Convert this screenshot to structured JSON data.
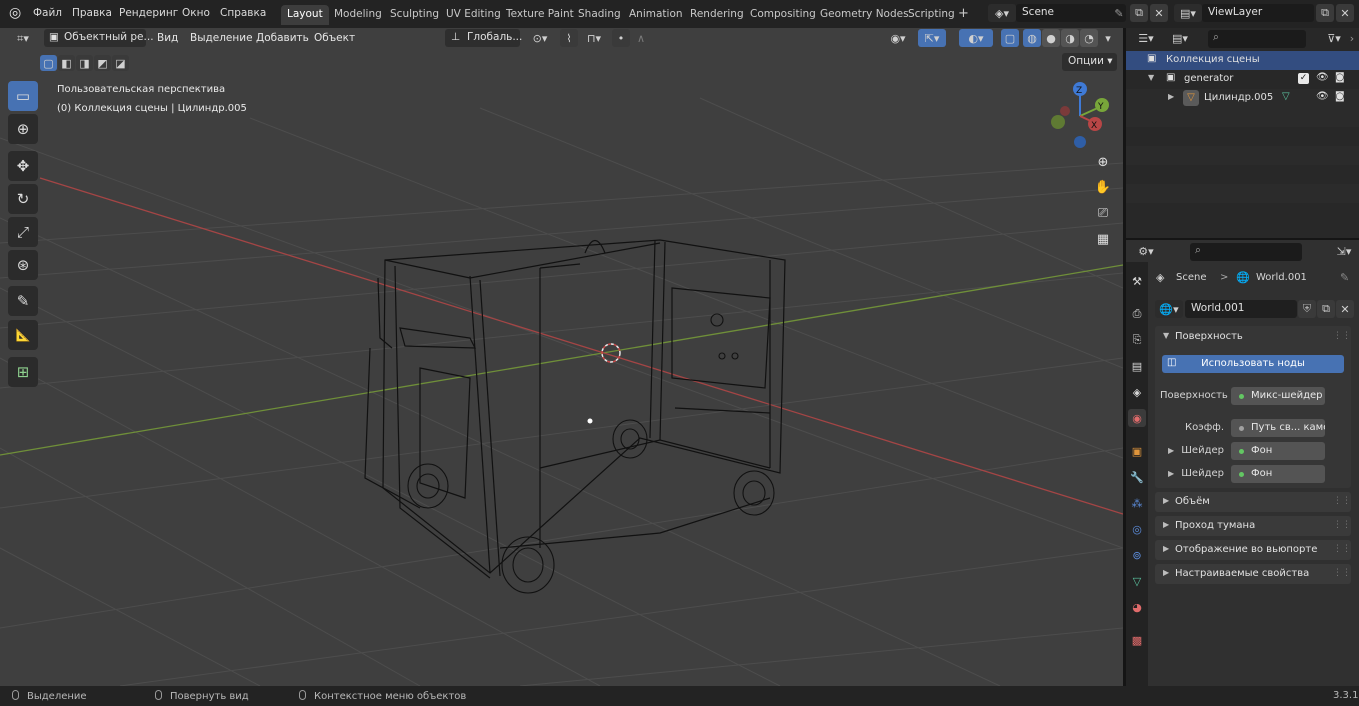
{
  "menu": [
    "Файл",
    "Правка",
    "Рендеринг",
    "Окно",
    "Справка"
  ],
  "workspaces": [
    "Layout",
    "Modeling",
    "Sculpting",
    "UV Editing",
    "Texture Paint",
    "Shading",
    "Animation",
    "Rendering",
    "Compositing",
    "Geometry Nodes",
    "Scripting"
  ],
  "active_workspace": "Layout",
  "add_workspace": "+",
  "scene_name": "Scene",
  "view_layer": "ViewLayer",
  "viewport_header": {
    "mode": "Объектный ре...",
    "menus": [
      "Вид",
      "Выделение",
      "Добавить",
      "Объект"
    ],
    "transform_orientation": "Глобаль...",
    "options": "Опции"
  },
  "viewport_overlay": {
    "view_name": "Пользовательская перспектива",
    "collection_info": "(0) Коллекция сцены | Цилиндр.005"
  },
  "gizmo_axes": {
    "x": "X",
    "y": "Y",
    "z": "Z"
  },
  "tools": [
    {
      "name": "select-box-tool",
      "icon": "▭"
    },
    {
      "name": "cursor-tool",
      "icon": "⊕"
    },
    {
      "name": "move-tool",
      "icon": "✥"
    },
    {
      "name": "rotate-tool",
      "icon": "↻"
    },
    {
      "name": "scale-tool",
      "icon": "⤢"
    },
    {
      "name": "transform-tool",
      "icon": "⊛"
    },
    {
      "name": "annotate-tool",
      "icon": "✎"
    },
    {
      "name": "measure-tool",
      "icon": "📐"
    },
    {
      "name": "add-cube-tool",
      "icon": "⊞"
    }
  ],
  "outliner": {
    "search_placeholder": "",
    "rows": [
      {
        "label": "Коллекция сцены",
        "level": 0
      },
      {
        "label": "generator",
        "level": 1
      },
      {
        "label": "Цилиндр.005",
        "level": 2
      }
    ]
  },
  "properties": {
    "breadcrumb_scene": "Scene",
    "breadcrumb_sep": ">",
    "breadcrumb_world": "World.001",
    "world_name": "World.001",
    "surface_panel": "Поверхность",
    "use_nodes_button": "Использовать ноды",
    "fields": [
      {
        "label": "Поверхность",
        "value": "Микс-шейдер"
      },
      {
        "label": "Коэфф.",
        "value": "Путь св... камер"
      },
      {
        "label": "Шейдер",
        "value": "Фон"
      },
      {
        "label": "Шейдер",
        "value": "Фон"
      }
    ],
    "collapsed_panels": [
      "Объём",
      "Проход тумана",
      "Отображение во вьюпорте",
      "Настраиваемые свойства"
    ]
  },
  "statusbar": {
    "items": [
      "Выделение",
      "Повернуть вид",
      "Контекстное меню объектов"
    ],
    "version": "3.3.1"
  },
  "colors": {
    "accent": "#4772b3",
    "x_axis": "#b84646",
    "y_axis": "#78a63a",
    "z_axis": "#3f7ad6",
    "viewport_bg": "#3f3f3f",
    "socket_green": "#63c763"
  }
}
